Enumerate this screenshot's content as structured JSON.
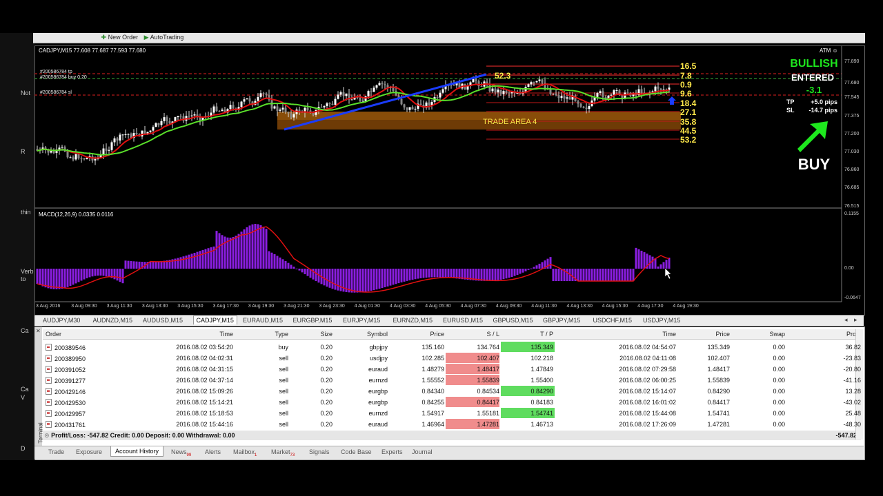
{
  "toolbar": {
    "new_order": "New Order",
    "auto_trading": "AutoTrading"
  },
  "left_labels": [
    "Not",
    "R",
    "thin",
    "Verb",
    "to",
    "Ca",
    "Ca",
    "V",
    "D"
  ],
  "chart": {
    "title": "CADJPY,M15  77.608 77.687 77.593 77.680",
    "atm_label": "ATM",
    "order_labels": [
      "#200586784 tp",
      "#200586784 buy 0.20",
      "#200586784 sl"
    ],
    "y_ticks": [
      "77.890",
      "77.680",
      "77.545",
      "77.375",
      "77.200",
      "77.030",
      "76.860",
      "76.685",
      "76.515"
    ],
    "x_ticks": [
      "3 Aug 2016",
      "3 Aug 09:30",
      "3 Aug 11:30",
      "3 Aug 13:30",
      "3 Aug 15:30",
      "3 Aug 17:30",
      "3 Aug 19:30",
      "3 Aug 21:30",
      "3 Aug 23:30",
      "4 Aug 01:30",
      "4 Aug 03:30",
      "4 Aug 05:30",
      "4 Aug 07:30",
      "4 Aug 09:30",
      "4 Aug 11:30",
      "4 Aug 13:30",
      "4 Aug 15:30",
      "4 Aug 17:30",
      "4 Aug 19:30"
    ],
    "fib_levels": [
      "16.5",
      "7.8",
      "0.9",
      "9.6",
      "18.4",
      "27.1",
      "35.8",
      "44.5",
      "53.2"
    ],
    "arrow_value": "52.3",
    "trade_area": "TRADE AREA 4",
    "macd_label": "MACD(12,26,9) 0.0335 0.0116",
    "macd_ticks": [
      "0.1155",
      "0.00",
      "-0.0647"
    ]
  },
  "signal": {
    "trend": "BULLISH",
    "status": "ENTERED",
    "pips": "-3.1",
    "tp_label": "TP",
    "tp_value": "+5.0 pips",
    "sl_label": "SL",
    "sl_value": "-14.7 pips",
    "action": "BUY",
    "colors": {
      "trend": "#1ee81e",
      "pips": "#1ee81e",
      "action": "#ffffff"
    }
  },
  "symbol_tabs": [
    "AUDJPY,M30",
    "AUDNZD,M15",
    "AUDUSD,M15",
    "CADJPY,M15",
    "EURAUD,M15",
    "EURGBP,M15",
    "EURJPY,M15",
    "EURNZD,M15",
    "EURUSD,M15",
    "GBPUSD,M15",
    "GBPJPY,M15",
    "USDCHF,M15",
    "USDJPY,M15"
  ],
  "terminal": {
    "side_label": "Terminal",
    "headers": [
      "Order",
      "Time",
      "Type",
      "Size",
      "Symbol",
      "Price",
      "S / L",
      "T / P",
      "Time",
      "Price",
      "Swap",
      "Profit"
    ],
    "rows": [
      {
        "order": "200389546",
        "time": "2016.08.02 03:54:20",
        "type": "buy",
        "size": "0.20",
        "symbol": "gbpjpy",
        "price": "135.160",
        "sl": "134.764",
        "tp": "135.349",
        "ctime": "2016.08.02 04:54:07",
        "cprice": "135.349",
        "swap": "0.00",
        "profit": "36.82",
        "sl_hl": false,
        "tp_hl": true
      },
      {
        "order": "200389950",
        "time": "2016.08.02 04:02:31",
        "type": "sell",
        "size": "0.20",
        "symbol": "usdjpy",
        "price": "102.285",
        "sl": "102.407",
        "tp": "102.218",
        "ctime": "2016.08.02 04:11:08",
        "cprice": "102.407",
        "swap": "0.00",
        "profit": "-23.83",
        "sl_hl": true,
        "tp_hl": false
      },
      {
        "order": "200391052",
        "time": "2016.08.02 04:31:15",
        "type": "sell",
        "size": "0.20",
        "symbol": "euraud",
        "price": "1.48279",
        "sl": "1.48417",
        "tp": "1.47849",
        "ctime": "2016.08.02 07:29:58",
        "cprice": "1.48417",
        "swap": "0.00",
        "profit": "-20.80",
        "sl_hl": true,
        "tp_hl": false
      },
      {
        "order": "200391277",
        "time": "2016.08.02 04:37:14",
        "type": "sell",
        "size": "0.20",
        "symbol": "eurnzd",
        "price": "1.55552",
        "sl": "1.55839",
        "tp": "1.55400",
        "ctime": "2016.08.02 06:00:25",
        "cprice": "1.55839",
        "swap": "0.00",
        "profit": "-41.16",
        "sl_hl": true,
        "tp_hl": false
      },
      {
        "order": "200429146",
        "time": "2016.08.02 15:09:26",
        "type": "sell",
        "size": "0.20",
        "symbol": "eurgbp",
        "price": "0.84340",
        "sl": "0.84534",
        "tp": "0.84290",
        "ctime": "2016.08.02 15:14:07",
        "cprice": "0.84290",
        "swap": "0.00",
        "profit": "13.28",
        "sl_hl": false,
        "tp_hl": true
      },
      {
        "order": "200429530",
        "time": "2016.08.02 15:14:21",
        "type": "sell",
        "size": "0.20",
        "symbol": "eurgbp",
        "price": "0.84255",
        "sl": "0.84417",
        "tp": "0.84183",
        "ctime": "2016.08.02 16:01:02",
        "cprice": "0.84417",
        "swap": "0.00",
        "profit": "-43.02",
        "sl_hl": true,
        "tp_hl": false
      },
      {
        "order": "200429957",
        "time": "2016.08.02 15:18:53",
        "type": "sell",
        "size": "0.20",
        "symbol": "eurnzd",
        "price": "1.54917",
        "sl": "1.55181",
        "tp": "1.54741",
        "ctime": "2016.08.02 15:44:08",
        "cprice": "1.54741",
        "swap": "0.00",
        "profit": "25.48",
        "sl_hl": false,
        "tp_hl": true
      },
      {
        "order": "200431761",
        "time": "2016.08.02 15:44:16",
        "type": "sell",
        "size": "0.20",
        "symbol": "euraud",
        "price": "1.46964",
        "sl": "1.47281",
        "tp": "1.46713",
        "ctime": "2016.08.02 17:26:09",
        "cprice": "1.47281",
        "swap": "0.00",
        "profit": "-48.30",
        "sl_hl": true,
        "tp_hl": false
      }
    ],
    "summary": "Profit/Loss: -547.82  Credit: 0.00  Deposit: 0.00  Withdrawal: 0.00",
    "summary_total": "-547.82"
  },
  "bottom_tabs": [
    {
      "label": "Trade",
      "badge": ""
    },
    {
      "label": "Exposure",
      "badge": ""
    },
    {
      "label": "Account History",
      "badge": ""
    },
    {
      "label": "News",
      "badge": "99"
    },
    {
      "label": "Alerts",
      "badge": ""
    },
    {
      "label": "Mailbox",
      "badge": "1"
    },
    {
      "label": "Market",
      "badge": "73"
    },
    {
      "label": "Signals",
      "badge": ""
    },
    {
      "label": "Code Base",
      "badge": ""
    },
    {
      "label": "Experts",
      "badge": ""
    },
    {
      "label": "Journal",
      "badge": ""
    }
  ],
  "active_symbol_tab": 3,
  "active_bottom_tab": 2
}
